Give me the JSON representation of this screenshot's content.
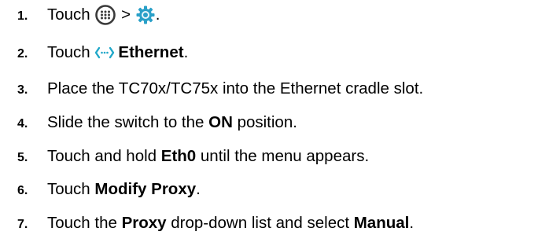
{
  "steps": [
    {
      "number": "1.",
      "parts": [
        {
          "type": "text",
          "value": "Touch "
        },
        {
          "type": "icon",
          "icon": "all-apps-icon"
        },
        {
          "type": "text",
          "value": " > "
        },
        {
          "type": "icon",
          "icon": "settings-gear-icon"
        },
        {
          "type": "text",
          "value": "."
        }
      ]
    },
    {
      "number": "2.",
      "parts": [
        {
          "type": "text",
          "value": "Touch "
        },
        {
          "type": "icon",
          "icon": "ethernet-icon"
        },
        {
          "type": "bold",
          "value": "Ethernet"
        },
        {
          "type": "text",
          "value": "."
        }
      ]
    },
    {
      "number": "3.",
      "parts": [
        {
          "type": "text",
          "value": "Place the TC70x/TC75x into the Ethernet cradle slot."
        }
      ]
    },
    {
      "number": "4.",
      "parts": [
        {
          "type": "text",
          "value": "Slide the switch to the "
        },
        {
          "type": "bold",
          "value": "ON"
        },
        {
          "type": "text",
          "value": " position."
        }
      ]
    },
    {
      "number": "5.",
      "parts": [
        {
          "type": "text",
          "value": "Touch and hold "
        },
        {
          "type": "bold",
          "value": "Eth0"
        },
        {
          "type": "text",
          "value": " until the menu appears."
        }
      ]
    },
    {
      "number": "6.",
      "parts": [
        {
          "type": "text",
          "value": "Touch "
        },
        {
          "type": "bold",
          "value": "Modify Proxy"
        },
        {
          "type": "text",
          "value": "."
        }
      ]
    },
    {
      "number": "7.",
      "parts": [
        {
          "type": "text",
          "value": "Touch the "
        },
        {
          "type": "bold",
          "value": "Proxy"
        },
        {
          "type": "text",
          "value": " drop-down list and select "
        },
        {
          "type": "bold",
          "value": "Manual"
        },
        {
          "type": "text",
          "value": "."
        }
      ]
    }
  ],
  "colors": {
    "text": "#000000",
    "ethernet_icon": "#21a8c9",
    "apps_icon": "#3a3a3a",
    "gear_icon": "#2aa0c8"
  }
}
